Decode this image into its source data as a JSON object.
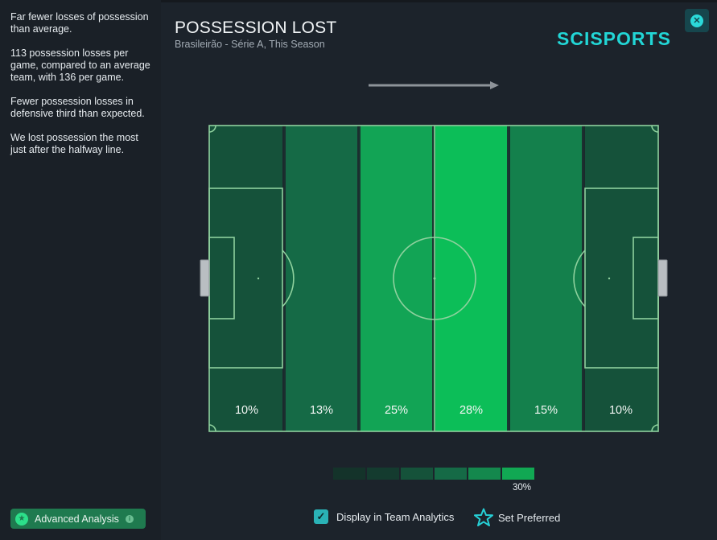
{
  "insights": [
    "Far fewer losses of possession than average.",
    "113 possession losses per game, compared to an average team, with 136 per game.",
    "Fewer possession losses in defensive third than expected.",
    "We lost possession the most just after the halfway line."
  ],
  "header": {
    "title": "POSSESSION LOST",
    "subtitle": "Brasileirão - Série A, This Season",
    "logo": "SCISPORTS",
    "close_icon": "close-icon"
  },
  "direction_icon": "right-arrow-icon",
  "zones": [
    {
      "label": "10%",
      "value": 10,
      "color": "#15523a"
    },
    {
      "label": "13%",
      "value": 13,
      "color": "#156a46"
    },
    {
      "label": "25%",
      "value": 25,
      "color": "#12a455"
    },
    {
      "label": "28%",
      "value": 28,
      "color": "#0cbe58"
    },
    {
      "label": "15%",
      "value": 15,
      "color": "#14804c"
    },
    {
      "label": "10%",
      "value": 10,
      "color": "#15523a"
    }
  ],
  "legend": {
    "colors": [
      "#14332a",
      "#143b2f",
      "#15523a",
      "#156a46",
      "#14884d",
      "#11a853"
    ],
    "max_label": "30%"
  },
  "footer": {
    "advanced_analysis": "Advanced Analysis",
    "display_in_team_analytics": "Display in Team Analytics",
    "display_checked": true,
    "set_preferred": "Set Preferred"
  },
  "colors": {
    "accent": "#22d6d6",
    "line": "#8fd19e",
    "background": "#1c232b"
  }
}
